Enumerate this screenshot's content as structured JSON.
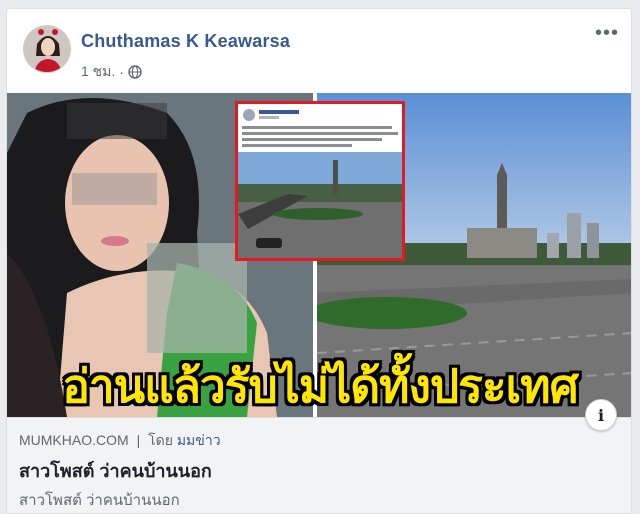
{
  "post": {
    "author": "Chuthamas K Keawarsa",
    "time": "1 ชม.",
    "privacy_icon": "globe-icon",
    "more_icon": "more-options-icon"
  },
  "media": {
    "headline": "อ่านแล้วรับไม่ได้ทั้งประเทศ",
    "info_icon": "info-icon",
    "info_label": "i"
  },
  "link": {
    "domain": "MUMKHAO.COM",
    "separator": "|",
    "by_label": "โดย",
    "by_name": "มมข่าว",
    "title": "สาวโพสต์ ว่าคนบ้านนอก",
    "description": "สาวโพสต์ ว่าคนบ้านนอก"
  },
  "colors": {
    "author_blue": "#385898",
    "headline_yellow": "#ffe600",
    "inset_border_red": "#e11b22",
    "link_box_bg": "#f2f3f5"
  }
}
